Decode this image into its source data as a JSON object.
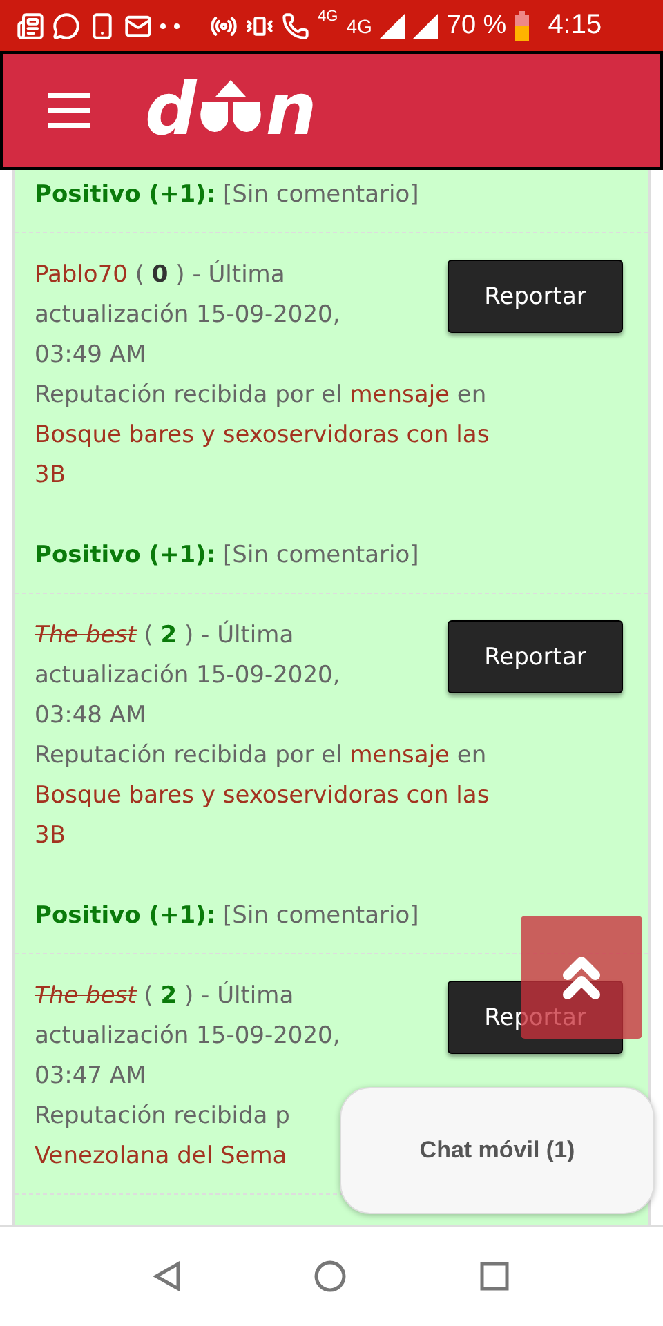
{
  "status_bar": {
    "network_labels": [
      "4G",
      "4G"
    ],
    "battery": "70 %",
    "time": "4:15"
  },
  "header": {
    "logo": {
      "left": "d",
      "right": "n"
    }
  },
  "entries": [
    {
      "rating": "Positivo (+1):",
      "comment": "[Sin comentario]"
    },
    {
      "user": "Pablo70",
      "struck": false,
      "score": "( **0** )",
      "score_positive": false,
      "updated_lines": [
        "- Última",
        "actualización 15-09-2020,",
        "03:49 AM"
      ],
      "reason": "Reputación recibida por el",
      "link": "mensaje",
      "link_suffix": "en",
      "thread": "Bosque bares y sexoservidoras con las 3B",
      "button": "Reportar",
      "rating": "Positivo (+1):",
      "comment": "[Sin comentario]"
    },
    {
      "user": "The best",
      "struck": true,
      "score": "( **2** )",
      "score_positive": true,
      "updated_lines": [
        "- Última",
        "actualización 15-09-2020,",
        "03:48 AM"
      ],
      "reason": "Reputación recibida por el",
      "link": "mensaje",
      "link_suffix": "en",
      "thread": "Bosque bares y sexoservidoras con las 3B",
      "button": "Reportar",
      "rating": "Positivo (+1):",
      "comment": "[Sin comentario]"
    },
    {
      "user": "The best",
      "struck": true,
      "score": "( **2** )",
      "score_positive": true,
      "updated_lines": [
        "- Última",
        "actualización 15-09-2020,",
        "03:47 AM"
      ],
      "reason": "Reputación recibida p",
      "thread": "Venezolana del Sema",
      "button": "Reportar"
    }
  ],
  "chat": {
    "label": "Chat móvil (1)"
  }
}
